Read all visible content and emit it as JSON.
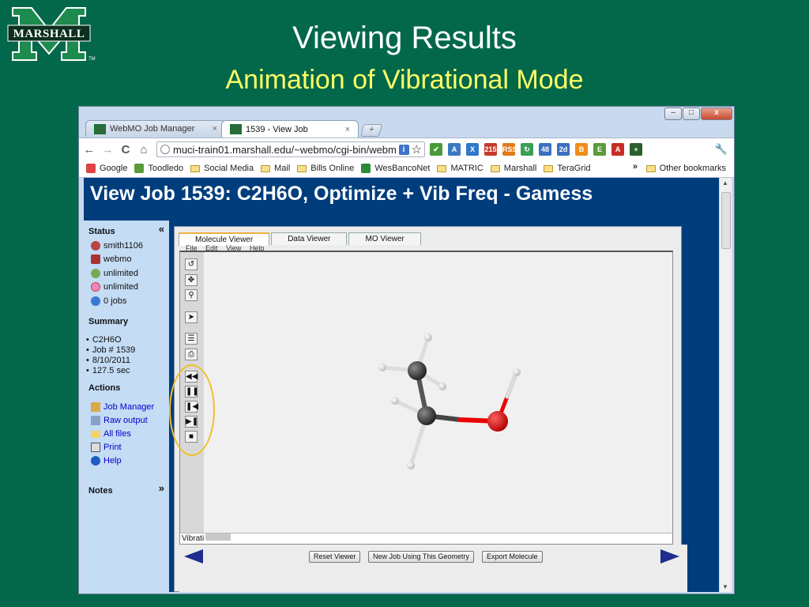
{
  "slide": {
    "logo_text": "MARSHALL",
    "logo_tm": "TM",
    "title": "Viewing Results",
    "subtitle": "Animation of Vibrational Mode"
  },
  "browser": {
    "tabs": [
      {
        "label": "WebMO Job Manager",
        "active": false
      },
      {
        "label": "1539 - View Job",
        "active": true
      }
    ],
    "tab_close": "×",
    "new_tab": "+",
    "window_controls": {
      "minimize": "–",
      "maximize": "□",
      "close": "x"
    },
    "nav": {
      "back": "←",
      "forward": "→",
      "reload": "C",
      "home": "⌂"
    },
    "url": "muci-train01.marshall.edu/~webmo/cgi-bin/webm",
    "url_info_icon": "i",
    "star": "☆",
    "wrench": "🔧",
    "extensions": [
      {
        "name": "check-icon",
        "color": "#4a9a3a",
        "label": "✔"
      },
      {
        "name": "translate-icon",
        "color": "#3a7ac0",
        "label": "A"
      },
      {
        "name": "mail-icon",
        "color": "#2f78c8",
        "label": "X"
      },
      {
        "name": "count-icon",
        "color": "#c43b2b",
        "label": "215"
      },
      {
        "name": "rss-icon",
        "color": "#e07a18",
        "label": "RSS"
      },
      {
        "name": "sync-icon",
        "color": "#3a9e55",
        "label": "↻"
      },
      {
        "name": "people-icon",
        "color": "#3b6fc1",
        "label": "48"
      },
      {
        "name": "calendar-icon",
        "color": "#3b6fc1",
        "label": "2d"
      },
      {
        "name": "blogger-icon",
        "color": "#f18d1a",
        "label": "B"
      },
      {
        "name": "evernote-icon",
        "color": "#5a9b3a",
        "label": "E"
      },
      {
        "name": "acrobat-icon",
        "color": "#c62e24",
        "label": "A"
      },
      {
        "name": "plus-icon",
        "color": "#2b5e2b",
        "label": "+"
      }
    ],
    "bookmarks": [
      {
        "label": "Google",
        "icon": "google-icon"
      },
      {
        "label": "Toodledo",
        "icon": "check-icon"
      },
      {
        "label": "Social Media",
        "icon": "folder-icon"
      },
      {
        "label": "Mail",
        "icon": "folder-icon"
      },
      {
        "label": "Bills Online",
        "icon": "folder-icon"
      },
      {
        "label": "WesBancoNet",
        "icon": "wesbanco-icon"
      },
      {
        "label": "MATRIC",
        "icon": "folder-icon"
      },
      {
        "label": "Marshall",
        "icon": "folder-icon"
      },
      {
        "label": "TeraGrid",
        "icon": "folder-icon"
      }
    ],
    "bookmarks_more": "»",
    "other_bookmarks": "Other bookmarks"
  },
  "page": {
    "job_title": "View Job 1539: C2H6O, Optimize + Vib Freq - Gamess",
    "sidebar": {
      "status_heading": "Status",
      "collapse": "«",
      "status_items": [
        "smith1106",
        "webmo",
        "unlimited",
        "unlimited",
        "0 jobs"
      ],
      "summary_heading": "Summary",
      "summary_items": [
        "C2H6O",
        "Job # 1539",
        "8/10/2011",
        "127.5 sec"
      ],
      "actions_heading": "Actions",
      "actions": [
        "Job Manager",
        "Raw output",
        "All files",
        "Print",
        "Help"
      ],
      "notes_heading": "Notes",
      "notes_expand": "»"
    },
    "viewer": {
      "tabs": [
        "Molecule Viewer",
        "Data Viewer",
        "MO Viewer"
      ],
      "menu": [
        "File",
        "Edit",
        "View",
        "Help"
      ],
      "status_text": "Vibrati",
      "buttons": [
        "Reset Viewer",
        "New Job Using This Geometry",
        "Export Molecule"
      ]
    }
  }
}
